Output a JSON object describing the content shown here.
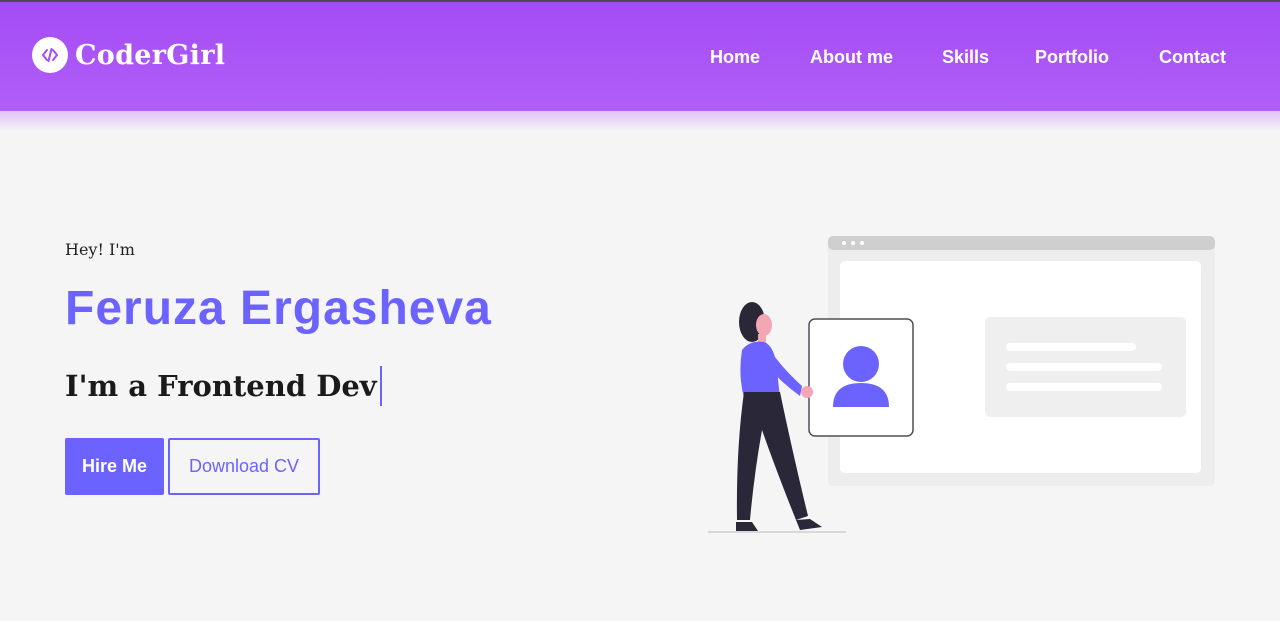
{
  "brand": {
    "name": "CoderGirl",
    "logo_icon": "code-icon"
  },
  "nav": {
    "items": [
      {
        "label": "Home"
      },
      {
        "label": "About me"
      },
      {
        "label": "Skills"
      },
      {
        "label": "Portfolio"
      },
      {
        "label": "Contact"
      }
    ]
  },
  "hero": {
    "greeting": "Hey! I'm",
    "name": "Feruza Ergasheva",
    "role": "I'm a Frontend Dev",
    "hire_label": "Hire Me",
    "cv_label": "Download CV"
  },
  "colors": {
    "header": "#a44cf5",
    "accent": "#6c63ff",
    "background": "#f5f5f5"
  }
}
